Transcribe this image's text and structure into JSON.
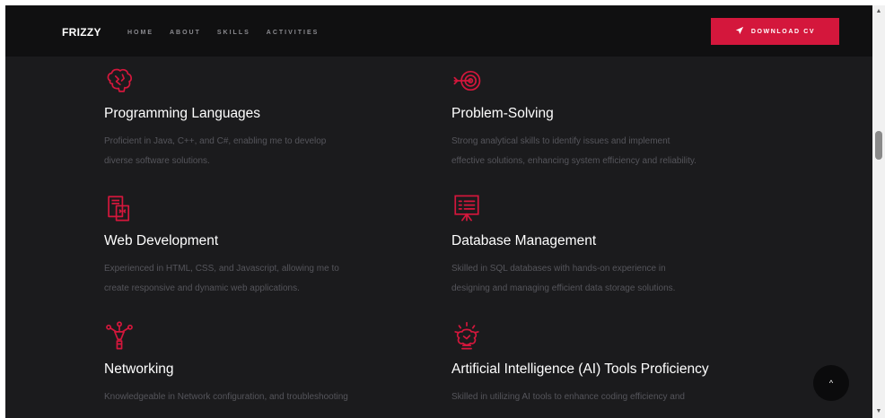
{
  "brand": "FRIZZY",
  "nav": [
    "HOME",
    "ABOUT",
    "SKILLS",
    "ACTIVITIES"
  ],
  "cta": {
    "label": "DOWNLOAD CV",
    "icon": "paper-plane-icon"
  },
  "accent_color": "#d4173c",
  "skills": [
    {
      "icon": "brain-icon",
      "title": "Programming Languages",
      "desc_line1": "Proficient in Java, C++, and C#, enabling me to develop",
      "desc_line2": "diverse software solutions."
    },
    {
      "icon": "target-icon",
      "title": "Problem-Solving",
      "desc_line1": "Strong analytical skills to identify issues and implement",
      "desc_line2": "effective solutions, enhancing system efficiency and reliability."
    },
    {
      "icon": "code-files-icon",
      "title": "Web Development",
      "desc_line1": "Experienced in HTML, CSS, and Javascript, allowing me to",
      "desc_line2": "create responsive and dynamic web applications."
    },
    {
      "icon": "presentation-board-icon",
      "title": "Database Management",
      "desc_line1": "Skilled in SQL databases with hands-on experience in",
      "desc_line2": "designing and managing efficient data storage solutions."
    },
    {
      "icon": "network-pen-icon",
      "title": "Networking",
      "desc_line1": "Knowledgeable in Network configuration, and troubleshooting",
      "desc_line2": ""
    },
    {
      "icon": "ai-brain-bulb-icon",
      "title": "Artificial Intelligence (AI) Tools Proficiency",
      "desc_line1": "Skilled in utilizing AI tools to enhance coding efficiency and",
      "desc_line2": ""
    }
  ],
  "scroll_top_symbol": "^"
}
